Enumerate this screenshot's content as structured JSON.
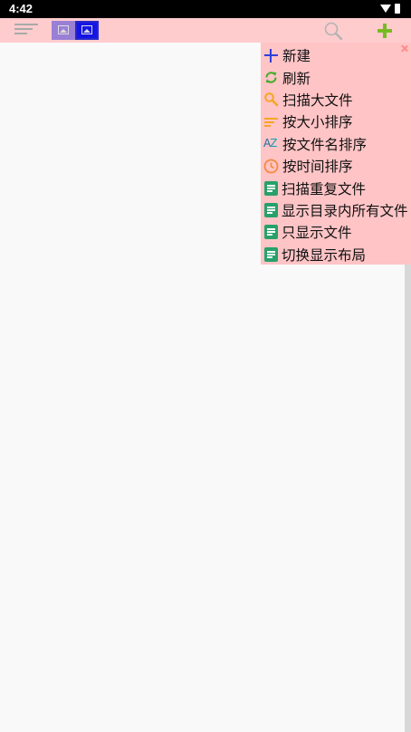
{
  "status_bar": {
    "time": "4:42",
    "icons": [
      "wifi-icon",
      "battery-icon"
    ]
  },
  "toolbar": {
    "icons": [
      "sort-lines-icon",
      "grid-view-icon",
      "list-view-icon",
      "search-icon",
      "add-icon"
    ],
    "accent_color": "#ffccce",
    "add_color": "#77bb22",
    "view_colors": [
      "#9a7fd6",
      "#1414e6"
    ]
  },
  "menu": {
    "background": "#ffc4c6",
    "close_icon": "close-icon",
    "items": [
      {
        "label": "新建",
        "icon": "plus-icon"
      },
      {
        "label": "刷新",
        "icon": "refresh-icon"
      },
      {
        "label": "扫描大文件",
        "icon": "search-icon"
      },
      {
        "label": "按大小排序",
        "icon": "sort-lines-icon"
      },
      {
        "label": "按文件名排序",
        "icon": "az-sort-icon"
      },
      {
        "label": "按时间排序",
        "icon": "clock-icon"
      },
      {
        "label": "扫描重复文件",
        "icon": "document-icon"
      },
      {
        "label": "显示目录内所有文件",
        "icon": "document-icon"
      },
      {
        "label": "只显示文件",
        "icon": "document-icon"
      },
      {
        "label": "切换显示布局",
        "icon": "document-icon"
      }
    ]
  },
  "icon_text": {
    "az_a": "A",
    "az_z": "Z"
  }
}
